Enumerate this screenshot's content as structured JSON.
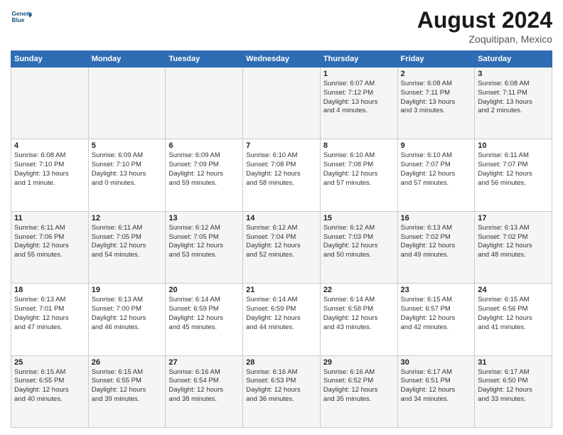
{
  "header": {
    "logo_line1": "General",
    "logo_line2": "Blue",
    "month": "August 2024",
    "location": "Zoquitipan, Mexico"
  },
  "weekdays": [
    "Sunday",
    "Monday",
    "Tuesday",
    "Wednesday",
    "Thursday",
    "Friday",
    "Saturday"
  ],
  "weeks": [
    [
      {
        "day": "",
        "info": ""
      },
      {
        "day": "",
        "info": ""
      },
      {
        "day": "",
        "info": ""
      },
      {
        "day": "",
        "info": ""
      },
      {
        "day": "1",
        "info": "Sunrise: 6:07 AM\nSunset: 7:12 PM\nDaylight: 13 hours\nand 4 minutes."
      },
      {
        "day": "2",
        "info": "Sunrise: 6:08 AM\nSunset: 7:11 PM\nDaylight: 13 hours\nand 3 minutes."
      },
      {
        "day": "3",
        "info": "Sunrise: 6:08 AM\nSunset: 7:11 PM\nDaylight: 13 hours\nand 2 minutes."
      }
    ],
    [
      {
        "day": "4",
        "info": "Sunrise: 6:08 AM\nSunset: 7:10 PM\nDaylight: 13 hours\nand 1 minute."
      },
      {
        "day": "5",
        "info": "Sunrise: 6:09 AM\nSunset: 7:10 PM\nDaylight: 13 hours\nand 0 minutes."
      },
      {
        "day": "6",
        "info": "Sunrise: 6:09 AM\nSunset: 7:09 PM\nDaylight: 12 hours\nand 59 minutes."
      },
      {
        "day": "7",
        "info": "Sunrise: 6:10 AM\nSunset: 7:08 PM\nDaylight: 12 hours\nand 58 minutes."
      },
      {
        "day": "8",
        "info": "Sunrise: 6:10 AM\nSunset: 7:08 PM\nDaylight: 12 hours\nand 57 minutes."
      },
      {
        "day": "9",
        "info": "Sunrise: 6:10 AM\nSunset: 7:07 PM\nDaylight: 12 hours\nand 57 minutes."
      },
      {
        "day": "10",
        "info": "Sunrise: 6:11 AM\nSunset: 7:07 PM\nDaylight: 12 hours\nand 56 minutes."
      }
    ],
    [
      {
        "day": "11",
        "info": "Sunrise: 6:11 AM\nSunset: 7:06 PM\nDaylight: 12 hours\nand 55 minutes."
      },
      {
        "day": "12",
        "info": "Sunrise: 6:11 AM\nSunset: 7:05 PM\nDaylight: 12 hours\nand 54 minutes."
      },
      {
        "day": "13",
        "info": "Sunrise: 6:12 AM\nSunset: 7:05 PM\nDaylight: 12 hours\nand 53 minutes."
      },
      {
        "day": "14",
        "info": "Sunrise: 6:12 AM\nSunset: 7:04 PM\nDaylight: 12 hours\nand 52 minutes."
      },
      {
        "day": "15",
        "info": "Sunrise: 6:12 AM\nSunset: 7:03 PM\nDaylight: 12 hours\nand 50 minutes."
      },
      {
        "day": "16",
        "info": "Sunrise: 6:13 AM\nSunset: 7:02 PM\nDaylight: 12 hours\nand 49 minutes."
      },
      {
        "day": "17",
        "info": "Sunrise: 6:13 AM\nSunset: 7:02 PM\nDaylight: 12 hours\nand 48 minutes."
      }
    ],
    [
      {
        "day": "18",
        "info": "Sunrise: 6:13 AM\nSunset: 7:01 PM\nDaylight: 12 hours\nand 47 minutes."
      },
      {
        "day": "19",
        "info": "Sunrise: 6:13 AM\nSunset: 7:00 PM\nDaylight: 12 hours\nand 46 minutes."
      },
      {
        "day": "20",
        "info": "Sunrise: 6:14 AM\nSunset: 6:59 PM\nDaylight: 12 hours\nand 45 minutes."
      },
      {
        "day": "21",
        "info": "Sunrise: 6:14 AM\nSunset: 6:59 PM\nDaylight: 12 hours\nand 44 minutes."
      },
      {
        "day": "22",
        "info": "Sunrise: 6:14 AM\nSunset: 6:58 PM\nDaylight: 12 hours\nand 43 minutes."
      },
      {
        "day": "23",
        "info": "Sunrise: 6:15 AM\nSunset: 6:57 PM\nDaylight: 12 hours\nand 42 minutes."
      },
      {
        "day": "24",
        "info": "Sunrise: 6:15 AM\nSunset: 6:56 PM\nDaylight: 12 hours\nand 41 minutes."
      }
    ],
    [
      {
        "day": "25",
        "info": "Sunrise: 6:15 AM\nSunset: 6:55 PM\nDaylight: 12 hours\nand 40 minutes."
      },
      {
        "day": "26",
        "info": "Sunrise: 6:15 AM\nSunset: 6:55 PM\nDaylight: 12 hours\nand 39 minutes."
      },
      {
        "day": "27",
        "info": "Sunrise: 6:16 AM\nSunset: 6:54 PM\nDaylight: 12 hours\nand 38 minutes."
      },
      {
        "day": "28",
        "info": "Sunrise: 6:16 AM\nSunset: 6:53 PM\nDaylight: 12 hours\nand 36 minutes."
      },
      {
        "day": "29",
        "info": "Sunrise: 6:16 AM\nSunset: 6:52 PM\nDaylight: 12 hours\nand 35 minutes."
      },
      {
        "day": "30",
        "info": "Sunrise: 6:17 AM\nSunset: 6:51 PM\nDaylight: 12 hours\nand 34 minutes."
      },
      {
        "day": "31",
        "info": "Sunrise: 6:17 AM\nSunset: 6:50 PM\nDaylight: 12 hours\nand 33 minutes."
      }
    ]
  ]
}
